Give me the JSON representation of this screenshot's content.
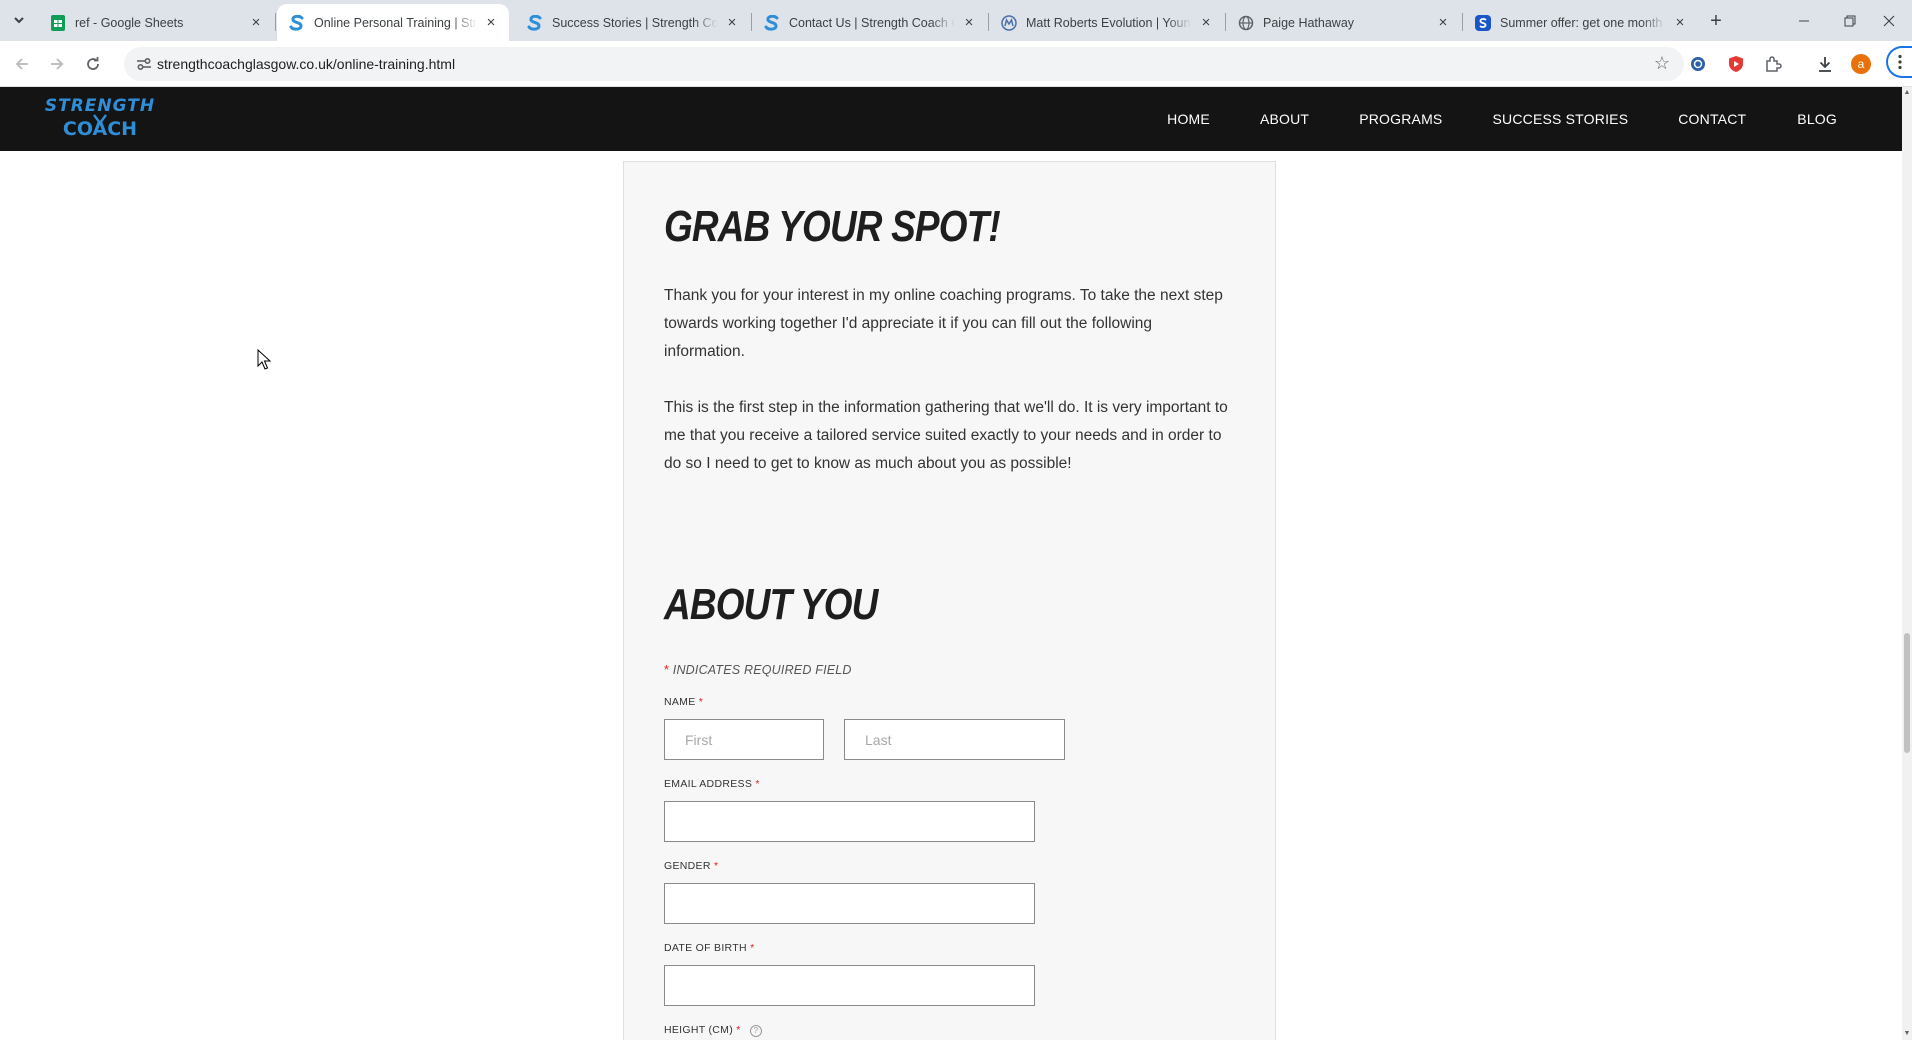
{
  "browser": {
    "tabs": [
      {
        "title": "ref - Google Sheets",
        "favicon": "sheets-icon",
        "active": false
      },
      {
        "title": "Online Personal Training | Strength Coach Glasgow",
        "favicon": "strength-coach-icon",
        "active": true
      },
      {
        "title": "Success Stories | Strength Coach Glasgow",
        "favicon": "strength-coach-icon",
        "active": false
      },
      {
        "title": "Contact Us | Strength Coach Glasgow",
        "favicon": "strength-coach-icon",
        "active": false
      },
      {
        "title": "Matt Roberts Evolution | Younger",
        "favicon": "matt-roberts-icon",
        "active": false
      },
      {
        "title": "Paige Hathaway",
        "favicon": "globe-icon",
        "active": false
      },
      {
        "title": "Summer offer: get one month free",
        "favicon": "offer-icon",
        "active": false
      }
    ],
    "url": "strengthcoachglasgow.co.uk/online-training.html",
    "profile_initial": "a"
  },
  "site": {
    "logo_line1": "STRENGTH",
    "logo_line2": "COACH",
    "nav": [
      "HOME",
      "ABOUT",
      "PROGRAMS",
      "SUCCESS STORIES",
      "CONTACT",
      "BLOG"
    ]
  },
  "main": {
    "heading": "GRAB YOUR SPOT!",
    "paragraph1": "Thank you for your interest in my online coaching programs. To take the next step towards working together I'd appreciate it if you can fill out the following information.",
    "paragraph2": "This is the first step in the information gathering that we'll do. It is very important to me that you receive a tailored service suited exactly to your needs and in order to do so I need to get to know as much about you as possible!",
    "form_heading": "ABOUT YOU",
    "required_note_star": "*",
    "required_note": "INDICATES REQUIRED FIELD",
    "fields": {
      "name_label": "NAME",
      "first_placeholder": "First",
      "last_placeholder": "Last",
      "email_label": "EMAIL ADDRESS",
      "gender_label": "GENDER",
      "dob_label": "DATE OF BIRTH",
      "height_label": "HEIGHT (CM)",
      "required_star": "*"
    }
  },
  "colors": {
    "brand_blue": "#2f8ed8",
    "header_bg": "#141414",
    "required_red": "#e0201b"
  }
}
